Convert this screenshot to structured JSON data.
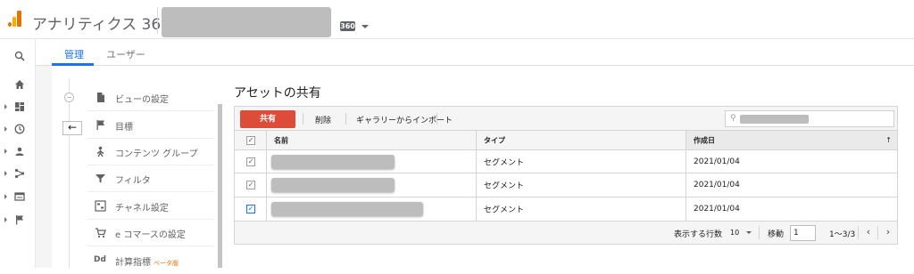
{
  "app": {
    "title": "アナリティクス 360",
    "badge": "360"
  },
  "tabs": [
    {
      "label": "管理",
      "active": true
    },
    {
      "label": "ユーザー",
      "active": false
    }
  ],
  "left_rail": [
    {
      "icon": "search-icon"
    },
    {
      "icon": "home-icon"
    },
    {
      "icon": "dashboard-icon",
      "expandable": true
    },
    {
      "icon": "clock-icon",
      "expandable": true
    },
    {
      "icon": "person-icon",
      "expandable": true
    },
    {
      "icon": "acquisition-icon",
      "expandable": true
    },
    {
      "icon": "behavior-icon",
      "expandable": true
    },
    {
      "icon": "flag-icon",
      "expandable": true
    }
  ],
  "view_nav": {
    "back_label": "←",
    "items": [
      {
        "icon": "document-icon",
        "label": "ビューの設定"
      },
      {
        "icon": "flag-icon",
        "label": "目標"
      },
      {
        "icon": "content-group-icon",
        "label": "コンテンツ グループ"
      },
      {
        "icon": "filter-icon",
        "label": "フィルタ"
      },
      {
        "icon": "channel-icon",
        "label": "チャネル設定"
      },
      {
        "icon": "cart-icon",
        "label": "e コマースの設定"
      },
      {
        "icon": "calc-metric-icon",
        "label": "計算指標",
        "icon_text": "Dd",
        "badge": "ベータ版"
      }
    ]
  },
  "main": {
    "title": "アセットの共有",
    "toolbar": {
      "share_label": "共有",
      "delete_label": "削除",
      "import_label": "ギャラリーからインポート"
    },
    "search": {
      "icon": "search-icon",
      "glyph": "⚲"
    },
    "table": {
      "header_check": "✓",
      "columns": [
        "名前",
        "タイプ",
        "作成日"
      ],
      "sort_indicator": "↑",
      "rows": [
        {
          "check": "✓",
          "checked_style": "gray",
          "type": "セグメント",
          "created": "2021/01/04"
        },
        {
          "check": "✓",
          "checked_style": "gray",
          "type": "セグメント",
          "created": "2021/01/04"
        },
        {
          "check": "✓",
          "checked_style": "blue",
          "type": "セグメント",
          "created": "2021/01/04"
        }
      ]
    },
    "footer": {
      "rows_label": "表示する行数",
      "rows_value": "10",
      "goto_label": "移動",
      "goto_value": "1",
      "range": "1～3/3",
      "prev": "‹",
      "next": "›"
    }
  },
  "colors": {
    "accent": "#1a73e8",
    "share_button": "#dd4b39",
    "logo_orange": "#f9ab00",
    "logo_dark_orange": "#e37400",
    "beta_badge": "#e37400"
  }
}
